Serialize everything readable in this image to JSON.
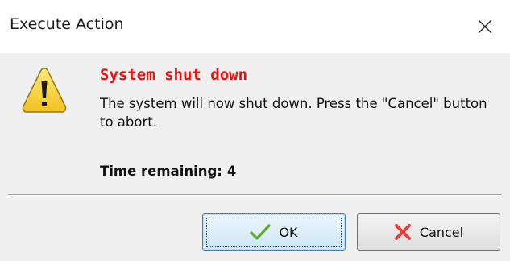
{
  "window": {
    "title": "Execute Action"
  },
  "icons": {
    "close": "close-icon",
    "warning": "warning-icon",
    "ok": "checkmark-icon",
    "cancel": "cross-icon"
  },
  "dialog": {
    "heading": "System shut down",
    "message": "The system will now shut down. Press the \"Cancel\" button to abort.",
    "timer_label": "Time remaining:",
    "timer_value": "4"
  },
  "buttons": {
    "ok_label": "OK",
    "cancel_label": "Cancel"
  },
  "colors": {
    "heading": "#e81010",
    "ok_check": "#5aab2c",
    "cancel_cross": "#e2403a",
    "warning_fill": "#f7d43c"
  }
}
